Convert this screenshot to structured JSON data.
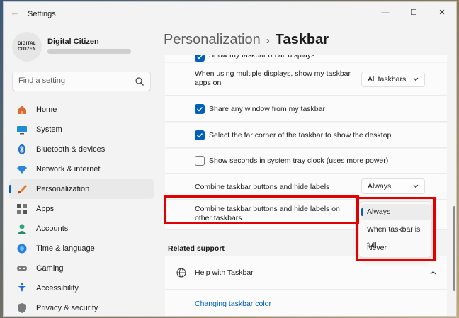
{
  "window": {
    "app_title": "Settings",
    "controls": {
      "minimize": "—",
      "maximize": "☐",
      "close": "✕"
    }
  },
  "user": {
    "avatar_text": "DIGITAL CITIZEN",
    "name": "Digital Citizen",
    "email": "•••••••••••••••••"
  },
  "search": {
    "placeholder": "Find a setting"
  },
  "nav": [
    {
      "label": "Home",
      "icon": "home-icon"
    },
    {
      "label": "System",
      "icon": "system-icon"
    },
    {
      "label": "Bluetooth & devices",
      "icon": "bluetooth-icon"
    },
    {
      "label": "Network & internet",
      "icon": "wifi-icon"
    },
    {
      "label": "Personalization",
      "icon": "brush-icon",
      "active": true
    },
    {
      "label": "Apps",
      "icon": "apps-icon"
    },
    {
      "label": "Accounts",
      "icon": "accounts-icon"
    },
    {
      "label": "Time & language",
      "icon": "globe-clock-icon"
    },
    {
      "label": "Gaming",
      "icon": "gamepad-icon"
    },
    {
      "label": "Accessibility",
      "icon": "accessibility-icon"
    },
    {
      "label": "Privacy & security",
      "icon": "shield-icon"
    }
  ],
  "breadcrumb": {
    "parent": "Personalization",
    "separator": "›",
    "current": "Taskbar"
  },
  "settings": {
    "show_all_displays": {
      "label": "Show my taskbar on all displays",
      "checked": true
    },
    "multi_display_apps": {
      "label": "When using multiple displays, show my taskbar apps on",
      "value": "All taskbars"
    },
    "share_window": {
      "label": "Share any window from my taskbar",
      "checked": true
    },
    "far_corner": {
      "label": "Select the far corner of the taskbar to show the desktop",
      "checked": true
    },
    "show_seconds": {
      "label": "Show seconds in system tray clock (uses more power)",
      "checked": false
    },
    "combine_buttons": {
      "label": "Combine taskbar buttons and hide labels",
      "value": "Always"
    },
    "combine_other": {
      "label": "Combine taskbar buttons and hide labels on other taskbars"
    }
  },
  "flyout": {
    "options": [
      "Always",
      "When taskbar is full",
      "Never"
    ],
    "selected": "Always"
  },
  "related_support": {
    "heading": "Related support",
    "help_title": "Help with Taskbar",
    "link": "Changing taskbar color"
  },
  "colors": {
    "accent": "#005fb8",
    "highlight": "#e00000"
  }
}
